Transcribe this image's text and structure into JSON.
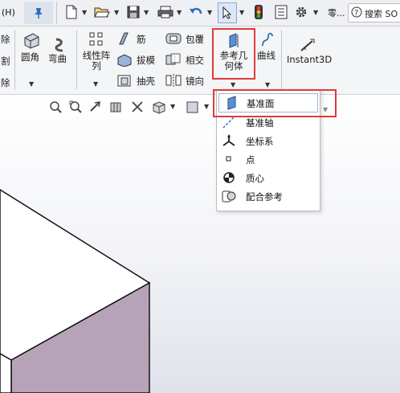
{
  "menu": {
    "help_fragment": "(H)",
    "pin": "pin-icon"
  },
  "quickbar": {
    "more_label": "零...",
    "search_placeholder": "搜索 SO"
  },
  "ribbon": {
    "col1": [
      "除",
      "割",
      "除"
    ],
    "fillet": "圆角",
    "bend": "弯曲",
    "linear_pattern": "线性阵列",
    "rib": "筋",
    "draft": "拔模",
    "shell": "抽壳",
    "wrap": "包覆",
    "intersect": "相交",
    "mirror": "镜向",
    "ref_geometry": "参考几何体",
    "curves": "曲线",
    "instant3d": "Instant3D"
  },
  "dropdown": {
    "items": [
      "基准面",
      "基准轴",
      "坐标系",
      "点",
      "质心",
      "配合参考"
    ]
  },
  "colors": {
    "accent_red": "#e03a3a",
    "cube_side": "#b7a3b8",
    "icon_blue": "#2d6fb6"
  }
}
